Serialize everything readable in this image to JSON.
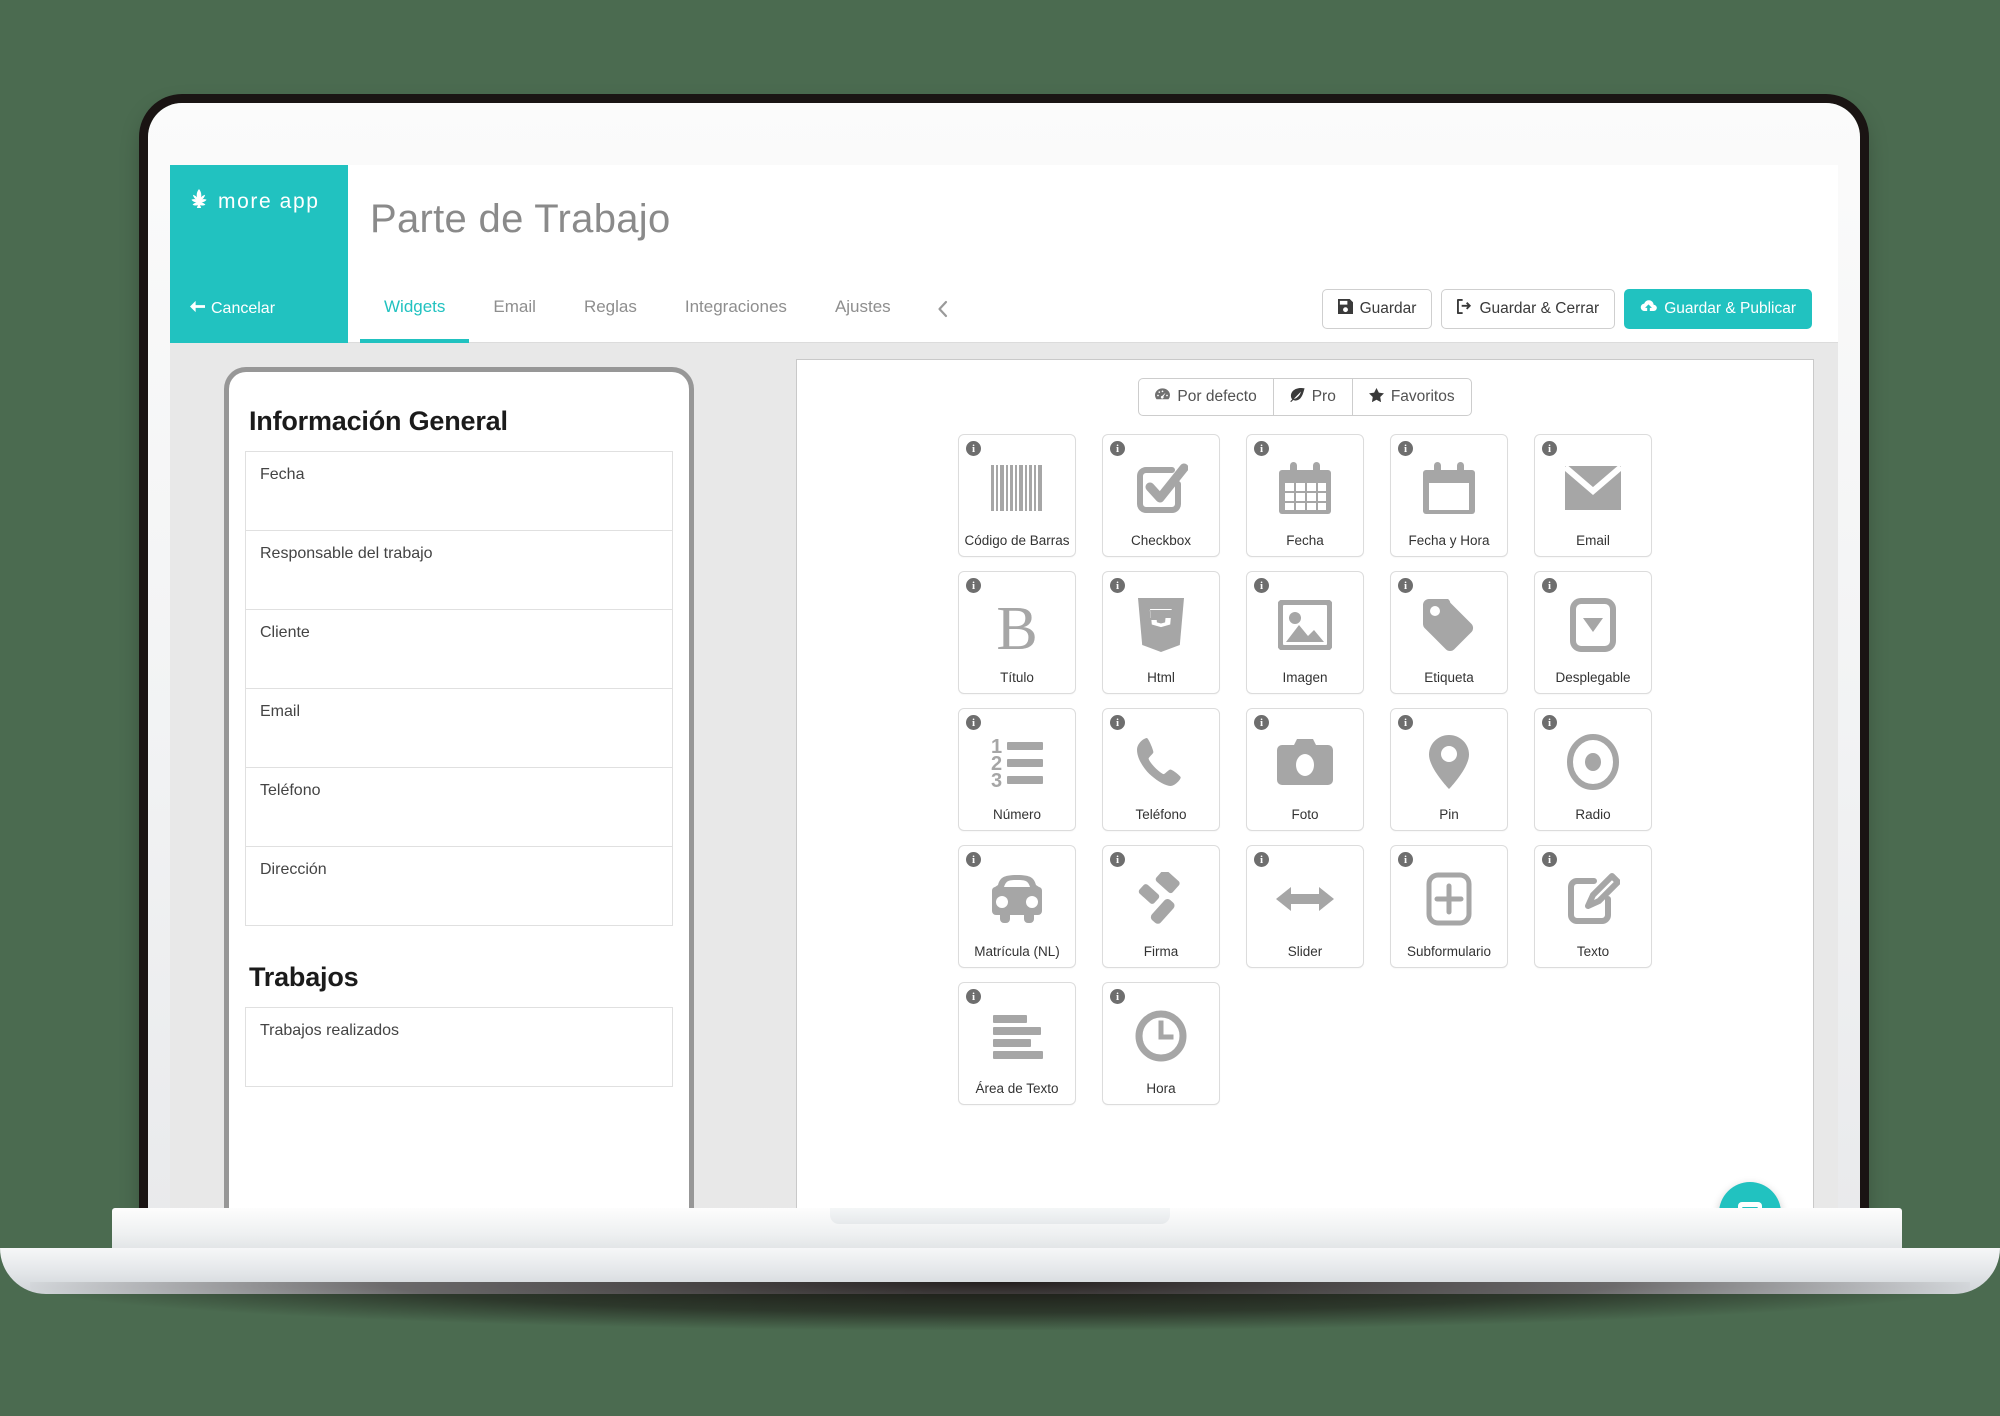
{
  "brand": {
    "name": "more app",
    "logo_icon": "wheat-sprout-icon",
    "accent_color": "#21c2c0"
  },
  "header": {
    "page_title": "Parte de Trabajo",
    "cancel_label": "Cancelar",
    "cancel_icon": "arrow-left-icon",
    "collapse_icon": "chevron-left-icon",
    "tabs": [
      {
        "label": "Widgets",
        "active": true
      },
      {
        "label": "Email",
        "active": false
      },
      {
        "label": "Reglas",
        "active": false
      },
      {
        "label": "Integraciones",
        "active": false
      },
      {
        "label": "Ajustes",
        "active": false
      }
    ],
    "actions": [
      {
        "label": "Guardar",
        "icon": "floppy-save-icon",
        "primary": false
      },
      {
        "label": "Guardar & Cerrar",
        "icon": "sign-out-icon",
        "primary": false
      },
      {
        "label": "Guardar & Publicar",
        "icon": "cloud-upload-icon",
        "primary": true
      }
    ]
  },
  "preview": {
    "sections": [
      {
        "title": "Información General",
        "fields": [
          "Fecha",
          "Responsable del trabajo",
          "Cliente",
          "Email",
          "Teléfono",
          "Dirección"
        ]
      },
      {
        "title": "Trabajos",
        "fields": [
          "Trabajos realizados"
        ]
      }
    ]
  },
  "widgets": {
    "filters": [
      {
        "label": "Por defecto",
        "icon": "dashboard-icon",
        "active": false
      },
      {
        "label": "Pro",
        "icon": "leaf-icon",
        "active": false
      },
      {
        "label": "Favoritos",
        "icon": "star-icon",
        "active": false
      }
    ],
    "info_badge_glyph": "i",
    "tiles": [
      {
        "label": "Código de Barras",
        "icon": "barcode-icon"
      },
      {
        "label": "Checkbox",
        "icon": "check-square-icon"
      },
      {
        "label": "Fecha",
        "icon": "calendar-icon"
      },
      {
        "label": "Fecha y Hora",
        "icon": "calendar-blank-icon"
      },
      {
        "label": "Email",
        "icon": "envelope-icon"
      },
      {
        "label": "Título",
        "icon": "bold-b-icon"
      },
      {
        "label": "Html",
        "icon": "html5-shield-icon"
      },
      {
        "label": "Imagen",
        "icon": "image-icon"
      },
      {
        "label": "Etiqueta",
        "icon": "tag-icon"
      },
      {
        "label": "Desplegable",
        "icon": "dropdown-caret-icon"
      },
      {
        "label": "Número",
        "icon": "ordered-list-icon"
      },
      {
        "label": "Teléfono",
        "icon": "phone-icon"
      },
      {
        "label": "Foto",
        "icon": "camera-icon"
      },
      {
        "label": "Pin",
        "icon": "map-pin-icon"
      },
      {
        "label": "Radio",
        "icon": "radio-button-icon"
      },
      {
        "label": "Matrícula (NL)",
        "icon": "car-icon"
      },
      {
        "label": "Firma",
        "icon": "gavel-icon"
      },
      {
        "label": "Slider",
        "icon": "arrows-horizontal-icon"
      },
      {
        "label": "Subformulario",
        "icon": "plus-square-icon"
      },
      {
        "label": "Texto",
        "icon": "pencil-square-icon"
      },
      {
        "label": "Área de Texto",
        "icon": "text-lines-icon"
      },
      {
        "label": "Hora",
        "icon": "clock-icon"
      }
    ]
  },
  "chat": {
    "icon": "chat-bubble-icon"
  }
}
